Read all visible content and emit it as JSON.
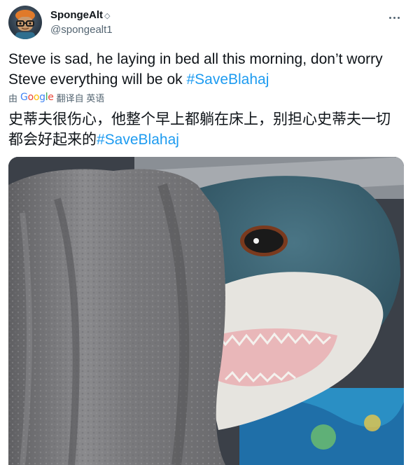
{
  "user": {
    "display_name": "SpongeAlt",
    "badge_glyph": "◇",
    "handle": "@spongealt1"
  },
  "icons": {
    "more": "more-horizontal-icon",
    "avatar": "cartoon-avatar-image"
  },
  "tweet": {
    "text": "Steve is sad, he laying in bed all this morning, don’t worry Steve everything will be ok ",
    "hashtag": "#SaveBlahaj"
  },
  "translation": {
    "prefix": "由",
    "provider_letters": [
      "G",
      "o",
      "o",
      "g",
      "l",
      "e"
    ],
    "suffix": "翻译自 英语",
    "text": "史蒂夫很伤心，他整个早上都躺在床上，别担心史蒂夫一切都会好起来的",
    "hashtag": "#SaveBlahaj"
  },
  "colors": {
    "link": "#1d9bf0",
    "secondary_text": "#536471",
    "primary_text": "#0f1419"
  }
}
